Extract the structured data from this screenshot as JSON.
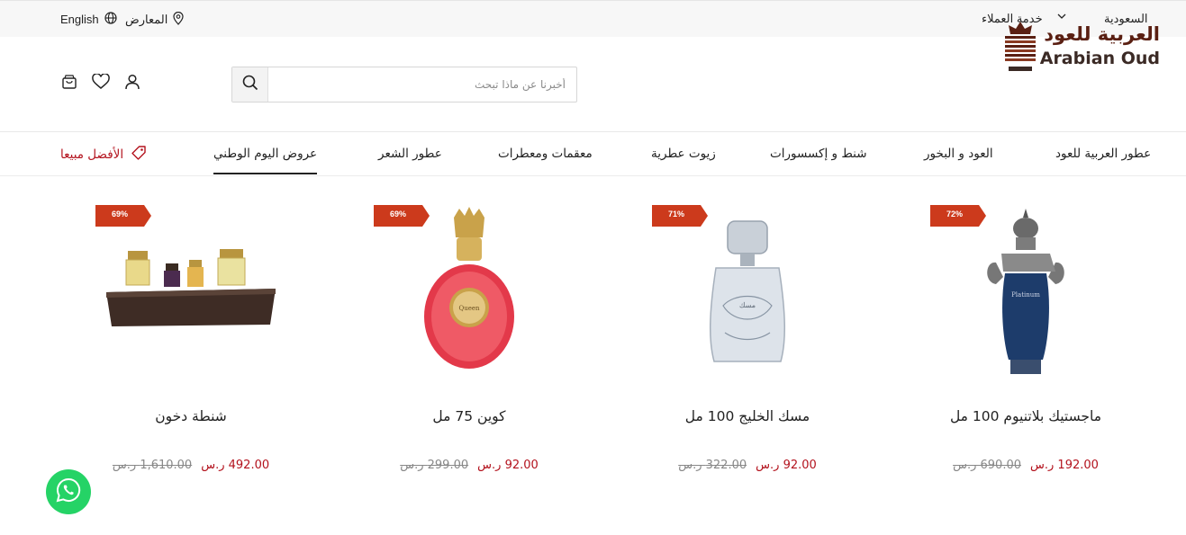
{
  "topbar": {
    "country": "السعودية",
    "customer_service": "خدمة العملاء",
    "showrooms": "المعارض",
    "language": "English"
  },
  "brand": {
    "name_ar": "العربية للعود",
    "name_en": "Arabian Oud"
  },
  "search": {
    "placeholder": "أخبرنا عن ماذا تبحث"
  },
  "nav": {
    "items": [
      "عطور العربية للعود",
      "العود و البخور",
      "شنط و إكسسورات",
      "زيوت عطرية",
      "معقمات ومعطرات",
      "عطور الشعر",
      "عروض اليوم الوطني",
      "الأفضل مبيعا"
    ],
    "active_index": 6
  },
  "products": [
    {
      "name": "ماجستيك بلاتنيوم 100 مل",
      "discount": "72%",
      "old_price": "690.00 ر.س",
      "new_price": "192.00 ر.س"
    },
    {
      "name": "مسك الخليج 100 مل",
      "discount": "71%",
      "old_price": "322.00 ر.س",
      "new_price": "92.00 ر.س"
    },
    {
      "name": "كوين 75 مل",
      "discount": "69%",
      "old_price": "299.00 ر.س",
      "new_price": "92.00 ر.س"
    },
    {
      "name": "شنطة دخون",
      "discount": "69%",
      "old_price": "1,610.00 ر.س",
      "new_price": "492.00 ر.س"
    }
  ],
  "colors": {
    "accent": "#b3121d",
    "badge": "#cc3a1c",
    "whatsapp": "#25d366"
  }
}
